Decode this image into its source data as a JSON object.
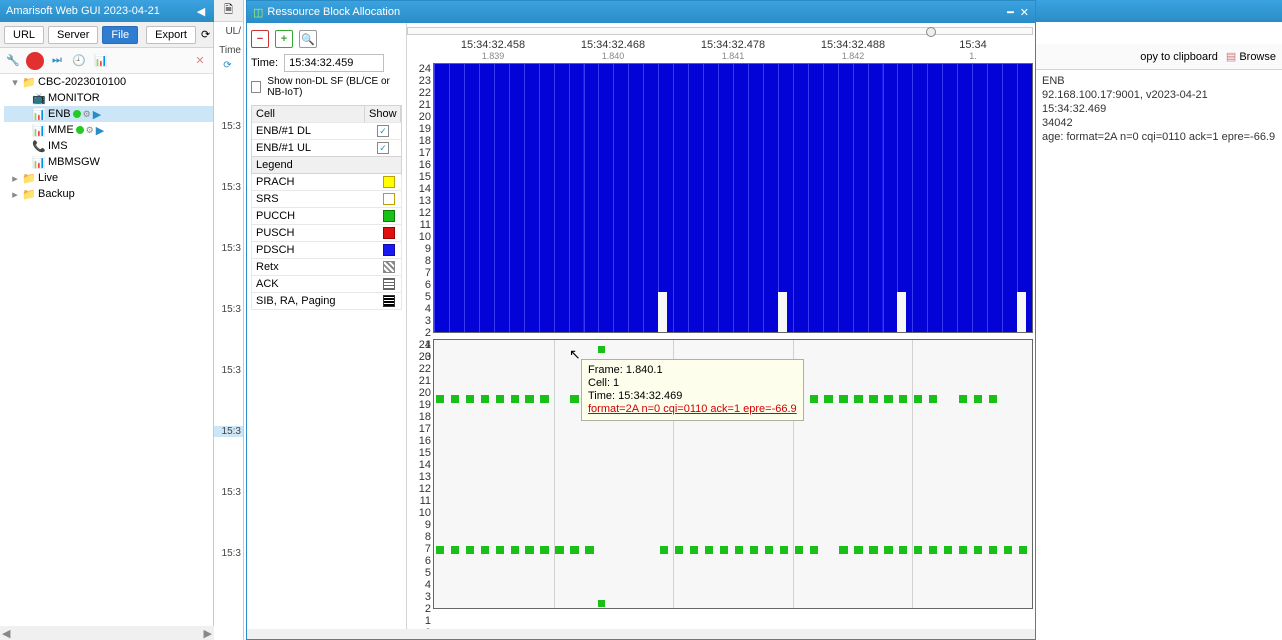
{
  "app": {
    "title": "Amarisoft Web GUI 2023-04-21"
  },
  "sidebar": {
    "toolbar1": {
      "url": "URL",
      "server": "Server",
      "file": "File",
      "export": "Export"
    },
    "tree": {
      "root": "CBC-2023010100",
      "items": [
        {
          "label": "MONITOR",
          "status": false,
          "icon": "📺"
        },
        {
          "label": "ENB",
          "status": true,
          "selected": true,
          "icon": "📊"
        },
        {
          "label": "MME",
          "status": true,
          "icon": "📊"
        },
        {
          "label": "IMS",
          "status": false,
          "icon": "📞"
        },
        {
          "label": "MBMSGW",
          "status": false,
          "icon": "📊"
        }
      ],
      "live": "Live",
      "backup": "Backup"
    }
  },
  "mid": {
    "header": "UL/",
    "time_label": "Time",
    "times": [
      "15:3",
      "15:3",
      "15:3",
      "15:3",
      "15:3",
      "15:3",
      "15:3",
      "15:3"
    ],
    "sel_index": 5
  },
  "dialog": {
    "title": "Ressource Block Allocation",
    "time_label": "Time:",
    "time_value": "15:34:32.459",
    "show_nondl": "Show non-DL SF (BL/CE or NB-IoT)",
    "cell_col": "Cell",
    "show_col": "Show",
    "cells": [
      {
        "name": "ENB/#1 DL",
        "shown": true
      },
      {
        "name": "ENB/#1 UL",
        "shown": true
      }
    ],
    "legend_title": "Legend",
    "legend": [
      {
        "name": "PRACH",
        "bg": "#ffff00",
        "border": "#c0a000"
      },
      {
        "name": "SRS",
        "bg": "#ffffff",
        "border": "#c0a000"
      },
      {
        "name": "PUCCH",
        "bg": "#18c018",
        "border": "#0e7a0e"
      },
      {
        "name": "PUSCH",
        "bg": "#e01010",
        "border": "#900"
      },
      {
        "name": "PDSCH",
        "bg": "#1818f0",
        "border": "#0e0ea0"
      },
      {
        "name": "Retx",
        "bg": "repeating-linear-gradient(45deg,#888,#888 2px,#fff 2px,#fff 4px)",
        "border": "#888"
      },
      {
        "name": "ACK",
        "bg": "repeating-linear-gradient(0deg,#666,#666 1px,#fff 1px,#fff 3px)",
        "border": "#666"
      },
      {
        "name": "SIB, RA, Paging",
        "bg": "repeating-linear-gradient(0deg,#000,#000 2px,#fff 2px,#fff 3px)",
        "border": "#333"
      }
    ]
  },
  "chart_data": {
    "type": "area",
    "x_ticks": [
      {
        "t": "15:34:32.458",
        "sub": "1.839"
      },
      {
        "t": "15:34:32.468",
        "sub": "1.840"
      },
      {
        "t": "15:34:32.478",
        "sub": "1.841"
      },
      {
        "t": "15:34:32.488",
        "sub": "1.842"
      },
      {
        "t": "15:34",
        "sub": "1."
      }
    ],
    "y_ticks": [
      0,
      1,
      2,
      3,
      4,
      5,
      6,
      7,
      8,
      9,
      10,
      11,
      12,
      13,
      14,
      15,
      16,
      17,
      18,
      19,
      20,
      21,
      22,
      23,
      24
    ],
    "dl": {
      "rb_max": 24,
      "gaps_at_subframe": [
        15,
        23,
        31,
        39
      ]
    },
    "ul": {
      "rb_max": 24,
      "row19": {
        "value": 19
      },
      "row5": {
        "value": 5
      },
      "srs_at": {
        "x": 11,
        "y": 24
      },
      "bottom_at": {
        "x": 11,
        "y": 0
      }
    },
    "marker_pos_pct": 83
  },
  "tooltip": {
    "frame": "Frame: 1.840.1",
    "cell": "Cell: 1",
    "time": "Time: 15:34:32.469",
    "detail": "format=2A n=0 cqi=0110 ack=1 epre=-66.9"
  },
  "right": {
    "copy": "opy to clipboard",
    "browse": "Browse",
    "lines": [
      "ENB",
      "92.168.100.17:9001, v2023-04-21",
      "15:34:32.469",
      "34042",
      "age: format=2A n=0 cqi=0110 ack=1 epre=-66.9"
    ]
  }
}
